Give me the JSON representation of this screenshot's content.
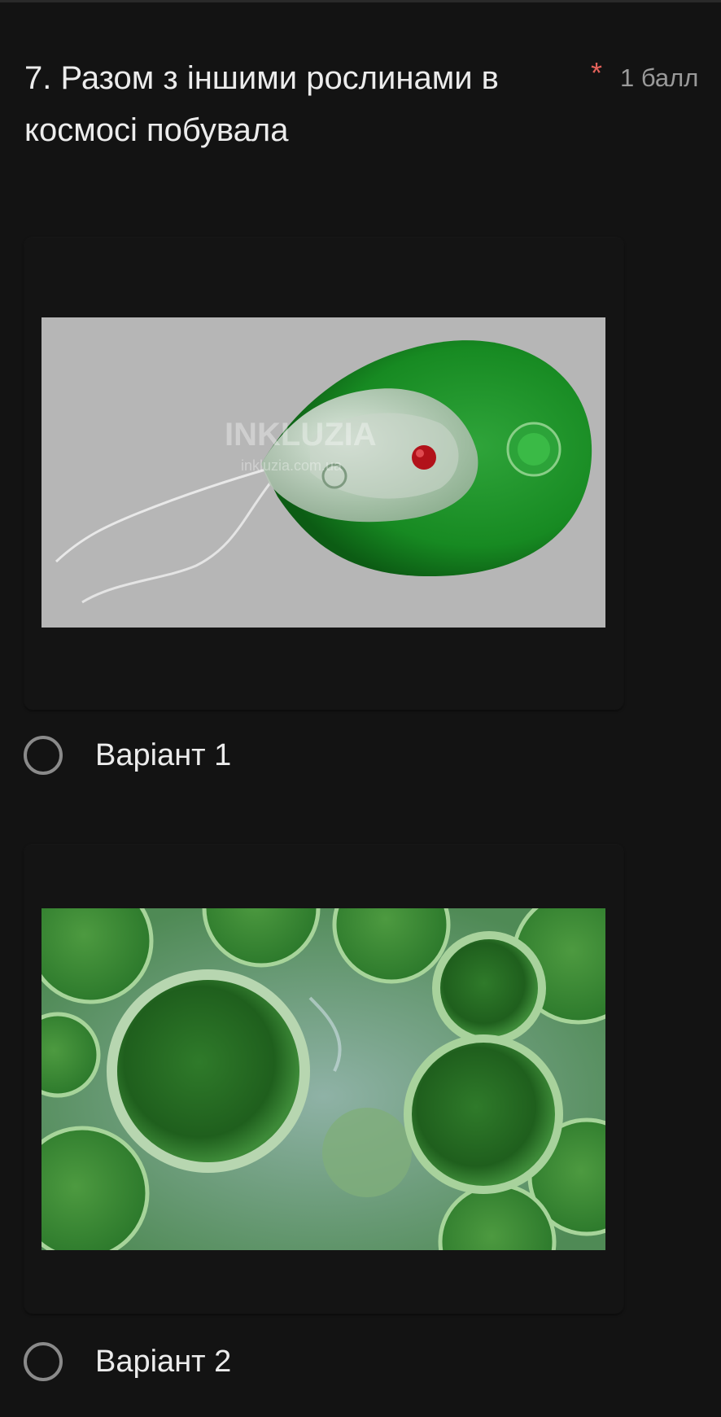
{
  "question": {
    "title": "7. Разом з іншими рослинами в космосі побувала",
    "required_mark": "*",
    "points": "1 балл"
  },
  "options": [
    {
      "label": "Варіант 1",
      "image_watermark": "INKLUZIA",
      "image_watermark_sub": "inkluzia.com.ua",
      "selected": false
    },
    {
      "label": "Варіант 2",
      "selected": false
    }
  ],
  "colors": {
    "background": "#131313",
    "text": "#ececec",
    "required": "#e2615a",
    "muted": "#9a9a9a",
    "radio_border": "#8a8a8a"
  }
}
